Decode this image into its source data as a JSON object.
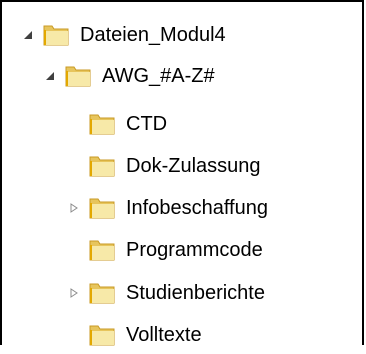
{
  "tree": {
    "root": {
      "label": "Dateien_Modul4",
      "icon": "folder-icon",
      "expander": "expanded-triangle-icon",
      "children": [
        {
          "label": "AWG_#A-Z#",
          "icon": "folder-icon",
          "expander": "expanded-triangle-icon",
          "children": [
            {
              "label": "CTD",
              "icon": "folder-icon",
              "expander": "none"
            },
            {
              "label": "Dok-Zulassung",
              "icon": "folder-icon",
              "expander": "none"
            },
            {
              "label": "Infobeschaffung",
              "icon": "folder-icon",
              "expander": "collapsed-triangle-icon"
            },
            {
              "label": "Programmcode",
              "icon": "folder-icon",
              "expander": "none"
            },
            {
              "label": "Studienberichte",
              "icon": "folder-icon",
              "expander": "collapsed-triangle-icon"
            },
            {
              "label": "Volltexte",
              "icon": "folder-icon",
              "expander": "none"
            }
          ]
        }
      ]
    }
  },
  "colors": {
    "folder_light": "#f7e9a8",
    "folder_mid": "#e7c55d",
    "folder_dark": "#c89a24",
    "folder_strip": "#e3a800",
    "triangle_dark": "#404040",
    "triangle_light": "#8c8c8c"
  }
}
